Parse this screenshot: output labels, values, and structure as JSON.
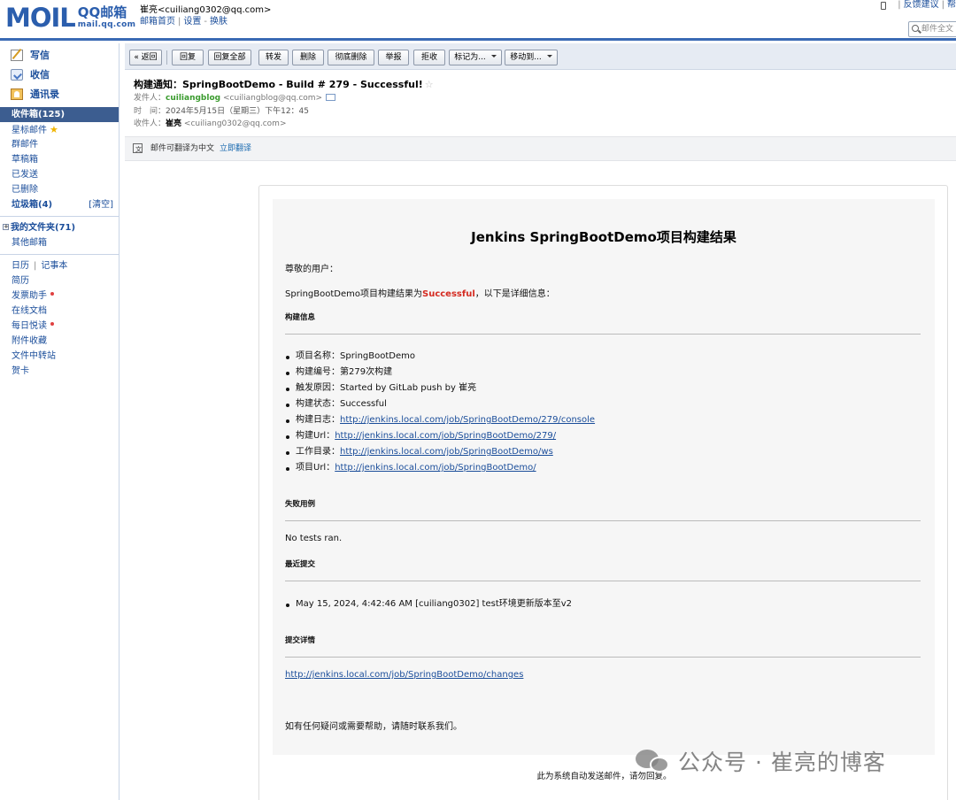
{
  "header": {
    "logo_text": "MOIL",
    "logo_qq": "QQ邮箱",
    "logo_domain": "mail.qq.com",
    "user_display": "崔亮<cuiliang0302@qq.com>",
    "links": [
      "邮箱首页",
      "设置",
      "换肤"
    ],
    "top_right_links": [
      "反馈建议",
      "帮"
    ],
    "search_placeholder": "邮件全文"
  },
  "sidebar": {
    "actions": [
      {
        "label": "写信",
        "icon": "compose-icon"
      },
      {
        "label": "收信",
        "icon": "receive-icon"
      },
      {
        "label": "通讯录",
        "icon": "contacts-icon"
      }
    ],
    "inbox": "收件箱(125)",
    "items": [
      "星标邮件",
      "群邮件",
      "草稿箱",
      "已发送",
      "已删除"
    ],
    "trash": "垃圾箱(4)",
    "trash_clear": "[清空]",
    "my_folders": "我的文件夹(71)",
    "other_mail": "其他邮箱",
    "calendar": "日历",
    "notes": "记事本",
    "tools": [
      "简历",
      "发票助手",
      "在线文档",
      "每日悦读",
      "附件收藏",
      "文件中转站",
      "贺卡"
    ]
  },
  "toolbar": {
    "back": "« 返回",
    "reply": "回复",
    "reply_all": "回复全部",
    "forward": "转发",
    "delete": "删除",
    "delete_permanent": "彻底删除",
    "report": "举报",
    "reject": "拒收",
    "mark_as": "标记为...",
    "move_to": "移动到..."
  },
  "message": {
    "subject": "构建通知：SpringBootDemo - Build # 279 - Successful!",
    "from_label": "发件人：",
    "from_name": "cuiliangblog",
    "from_email": "<cuiliangblog@qq.com>",
    "time_label": "时　间：",
    "time_value": "2024年5月15日（星期三）下午12：45",
    "to_label": "收件人：",
    "to_name": "崔亮",
    "to_email": "<cuiliang0302@qq.com>",
    "translate_text": "邮件可翻译为中文",
    "translate_link": "立即翻译"
  },
  "email": {
    "title": "Jenkins SpringBootDemo项目构建结果",
    "greeting": "尊敬的用户：",
    "intro_prefix": "SpringBootDemo项目构建结果为",
    "intro_status": "Successful",
    "intro_suffix": "，以下是详细信息：",
    "build_info_heading": "构建信息",
    "build_info": [
      {
        "label": "项目名称：",
        "value": "SpringBootDemo",
        "link": false
      },
      {
        "label": "构建编号：",
        "value": "第279次构建",
        "link": false
      },
      {
        "label": "触发原因：",
        "value": "Started by GitLab push by 崔亮",
        "link": false
      },
      {
        "label": "构建状态：",
        "value": "Successful",
        "link": false
      },
      {
        "label": "构建日志：",
        "value": "http://jenkins.local.com/job/SpringBootDemo/279/console",
        "link": true
      },
      {
        "label": "构建Url：",
        "value": "http://jenkins.local.com/job/SpringBootDemo/279/",
        "link": true
      },
      {
        "label": "工作目录：",
        "value": "http://jenkins.local.com/job/SpringBootDemo/ws",
        "link": true
      },
      {
        "label": "项目Url：",
        "value": "http://jenkins.local.com/job/SpringBootDemo/",
        "link": true
      }
    ],
    "failed_heading": "失败用例",
    "failed_text": "No tests ran.",
    "recent_heading": "最近提交",
    "recent_commits": [
      "May 15, 2024, 4:42:46 AM [cuiliang0302] test环境更新版本至v2"
    ],
    "details_heading": "提交详情",
    "details_link": "http://jenkins.local.com/job/SpringBootDemo/changes",
    "closing": "如有任何疑问或需要帮助，请随时联系我们。",
    "footer_note": "此为系统自动发送邮件，请勿回复。"
  },
  "watermark": "公众号 · 崔亮的博客",
  "colors": {
    "brand_blue": "#2b5ead",
    "inbox_selected": "#3c5d90",
    "link": "#1a4d9a",
    "success_red": "#d42a20",
    "sender_green": "#3a9b2e"
  }
}
